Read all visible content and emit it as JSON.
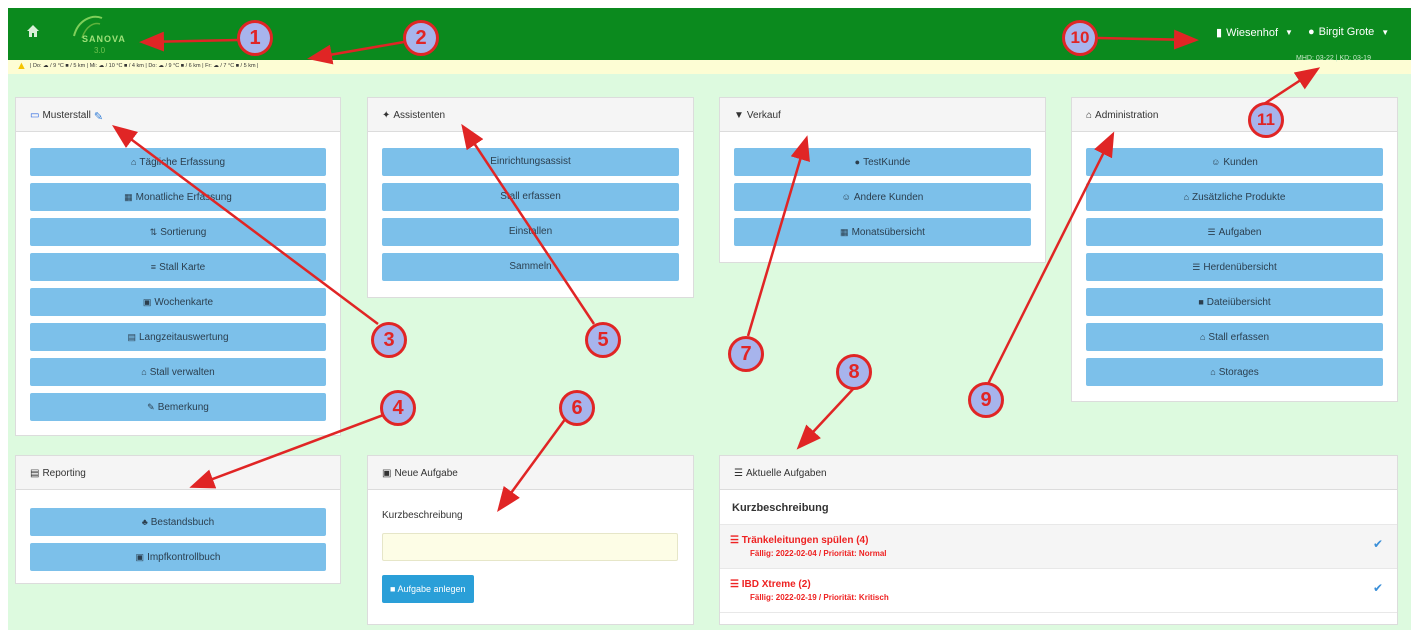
{
  "navbar": {
    "home_icon": "home-icon",
    "logo_text": "SANOVA",
    "logo_sub": "3.0",
    "farm_menu": "Wiesenhof",
    "user_menu": "Birgit Grote",
    "background": "#0b8a1e"
  },
  "weather": {
    "text": "| Do: ☁ / 9 °C ■ / 5 km | Mi: ☁ / 10 °C ■ / 4 km | Do: ☁ / 9 °C ■ / 6 km | Fr: ☁ / 7 °C ■ / 5 km |"
  },
  "mhd": "MHD: 03-22 | KD: 03-19",
  "panels": {
    "musterstall": {
      "title": "Musterstall",
      "buttons": [
        {
          "label": "Tägliche Erfassung",
          "icon": "⌂"
        },
        {
          "label": "Monatliche Erfassung",
          "icon": "▦"
        },
        {
          "label": "Sortierung",
          "icon": "⇅"
        },
        {
          "label": "Stall Karte",
          "icon": "≡"
        },
        {
          "label": "Wochenkarte",
          "icon": "▣"
        },
        {
          "label": "Langzeitauswertung",
          "icon": "▤"
        },
        {
          "label": "Stall verwalten",
          "icon": "⌂"
        },
        {
          "label": "Bemerkung",
          "icon": "✎"
        }
      ]
    },
    "assistenten": {
      "title": "Assistenten",
      "buttons": [
        {
          "label": "Einrichtungsassist"
        },
        {
          "label": "Stall erfassen"
        },
        {
          "label": "Einstallen"
        },
        {
          "label": "Sammeln"
        }
      ]
    },
    "verkauf": {
      "title": "Verkauf",
      "buttons": [
        {
          "label": "TestKunde",
          "icon": "●"
        },
        {
          "label": "Andere Kunden",
          "icon": "☺"
        },
        {
          "label": "Monatsübersicht",
          "icon": "▦"
        }
      ]
    },
    "administration": {
      "title": "Administration",
      "buttons": [
        {
          "label": "Kunden",
          "icon": "☺"
        },
        {
          "label": "Zusätzliche Produkte",
          "icon": "⌂"
        },
        {
          "label": "Aufgaben",
          "icon": "☰"
        },
        {
          "label": "Herdenübersicht",
          "icon": "☰"
        },
        {
          "label": "Dateiübersicht",
          "icon": "■"
        },
        {
          "label": "Stall erfassen",
          "icon": "⌂"
        },
        {
          "label": "Storages",
          "icon": "⌂"
        }
      ]
    },
    "reporting": {
      "title": "Reporting",
      "buttons": [
        {
          "label": "Bestandsbuch",
          "icon": "♣"
        },
        {
          "label": "Impfkontrollbuch",
          "icon": "▣"
        }
      ]
    },
    "neue_aufgabe": {
      "title": "Neue Aufgabe",
      "field_label": "Kurzbeschreibung",
      "field_value": "",
      "submit_label": "Aufgabe anlegen"
    },
    "aktuelle_aufgaben": {
      "title": "Aktuelle Aufgaben",
      "column_header": "Kurzbeschreibung",
      "tasks": [
        {
          "title": "Tränkeleitungen spülen (4)",
          "meta": "Fällig: 2022-02-04 / Priorität: Normal"
        },
        {
          "title": "IBD Xtreme (2)",
          "meta": "Fällig: 2022-02-19 / Priorität: Kritisch"
        }
      ]
    }
  },
  "callouts": [
    "1",
    "2",
    "3",
    "4",
    "5",
    "6",
    "7",
    "8",
    "9",
    "10",
    "11"
  ],
  "colors": {
    "accent_button": "#7cc0ea",
    "primary_button": "#2a9fd8",
    "content_bg": "#ddfadf",
    "callout_stroke": "#e02525",
    "callout_fill": "#a7b4ec",
    "task_text": "#ee2222"
  }
}
